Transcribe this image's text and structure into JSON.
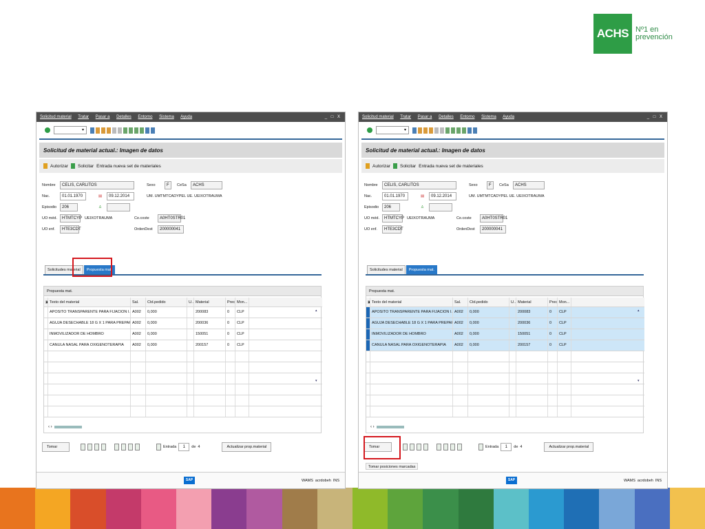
{
  "logo": {
    "mark": "ACHS",
    "tagline_1": "Nº1 en",
    "tagline_2": "prevención"
  },
  "brand_colors": {
    "green": "#2e9d46",
    "highlight": "#d4161c",
    "tab_active": "#2878c8",
    "selected_row": "#cde6f8"
  },
  "window": {
    "menu": [
      "Solicitud material",
      "Tratar",
      "Pasar a",
      "Detalles",
      "Entorno",
      "Sistema",
      "Ayuda"
    ],
    "window_controls": "_ □ X",
    "title": "Solicitud de material actual.: Imagen de datos",
    "appbar": {
      "autorizar": "Autorizar",
      "solicitar": "Solicitar",
      "entrada": "Entrada nueva set de materiales"
    },
    "fields": {
      "nombre_label": "Nombre",
      "nombre": "CELIS, CARLITOS",
      "sexo_label": "Sexo",
      "sexo": "F",
      "cesta_label": "CeSa",
      "cesta": "ACHS",
      "nac_label": "Nac.",
      "nac": "01.01.1970",
      "fecha": "09.12.2014",
      "um_text": "UM. UMTMTCADYPEL UE. UEIXOTRAUMA",
      "episodio_label": "Episodio",
      "episodio": "206",
      "uo_med_label": "UO méd.",
      "uo_med": "HTMTCYP",
      "uo_med_desc": "UEIXOTRAUMA",
      "ce_coste_label": "Ce.coste",
      "ce_coste": "A0HT0STR01",
      "uo_enf_label": "UO enf.",
      "uo_enf": "HTE3CDT",
      "orden_label": "OrdenDest",
      "orden": "200000041"
    },
    "tabs": [
      "Solicitudes material",
      "Propuesta mat."
    ],
    "panel_title": "Propuesta mat.",
    "columns": [
      "Texto del material",
      "Sal.",
      "Ctd.pedido",
      "U...",
      "Material",
      "Precio",
      "Mon..."
    ],
    "rows": [
      {
        "texto": "APOSITO TRANSPARENTE PARA FIJACION I.V.",
        "sal": "A002",
        "ctd": "0,000",
        "material": "200083",
        "precio": "0",
        "mon": "CLP"
      },
      {
        "texto": "AGUJA DESECHABLE 18 G X 1 PARA PREPARACI",
        "sal": "A002",
        "ctd": "0,000",
        "material": "200036",
        "precio": "0",
        "mon": "CLP"
      },
      {
        "texto": "INMOVILIZADOR DE HOMBRO",
        "sal": "A002",
        "ctd": "0,000",
        "material": "150051",
        "precio": "0",
        "mon": "CLP"
      },
      {
        "texto": "CANULA NASAL PARA OXIGENOTERAPIA",
        "sal": "A002",
        "ctd": "0,000",
        "material": "200157",
        "precio": "0",
        "mon": "CLP"
      }
    ],
    "bottom": {
      "tomar": "Tomar",
      "entrada_label": "Entrada",
      "entrada": "1",
      "de": "de",
      "total": "4",
      "actualizar": "Actualizar prop.material"
    },
    "status": {
      "sap": "SAP",
      "system": "WAMS",
      "user": "acrdobeh",
      "mode": "INS"
    },
    "message": "Tomar posiciones marcadas"
  }
}
